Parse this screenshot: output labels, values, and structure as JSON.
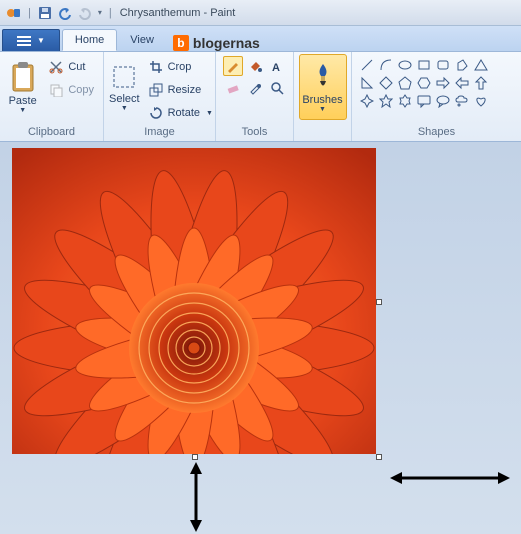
{
  "titlebar": {
    "separator": "|",
    "doc_title": "Chrysanthemum - Paint",
    "qat_dropdown": "▾"
  },
  "tabs": {
    "file_arrow": "▼",
    "home": "Home",
    "view": "View",
    "brand_text": "blogernas",
    "brand_badge": "b"
  },
  "ribbon": {
    "clipboard": {
      "paste": "Paste",
      "cut": "Cut",
      "copy": "Copy",
      "label": "Clipboard"
    },
    "image": {
      "select": "Select",
      "crop": "Crop",
      "resize": "Resize",
      "rotate": "Rotate",
      "label": "Image"
    },
    "tools": {
      "label": "Tools"
    },
    "brushes": {
      "label": "Brushes"
    },
    "shapes": {
      "label": "Shapes"
    }
  }
}
